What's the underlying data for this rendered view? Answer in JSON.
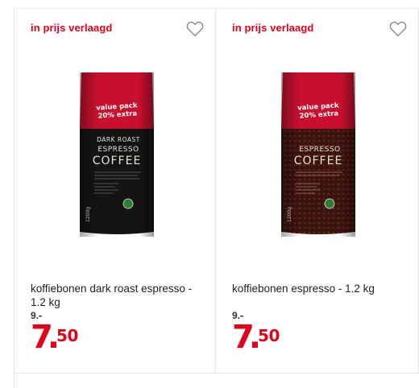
{
  "products": [
    {
      "badge": "in prijs verlaagd",
      "name": "koffiebonen dark roast espresso - 1.2 kg",
      "old_price": "9.-",
      "old_price_main": "9.",
      "old_price_dash": "-",
      "price_whole": "7",
      "price_dot": ".",
      "price_cents": "50",
      "pack": {
        "line1": "value pack",
        "line2": "20% extra",
        "sub": "DARK ROAST",
        "title1": "ESPRESSO",
        "title2": "COFFEE",
        "weight": "1200g"
      },
      "colors": {
        "top": "#c8102e",
        "body": "#141414"
      }
    },
    {
      "badge": "in prijs verlaagd",
      "name": "koffiebonen espresso - 1.2 kg",
      "old_price": "9.-",
      "old_price_main": "9.",
      "old_price_dash": "-",
      "price_whole": "7",
      "price_dot": ".",
      "price_cents": "50",
      "pack": {
        "line1": "value pack",
        "line2": "20% extra",
        "sub": "",
        "title1": "ESPRESSO",
        "title2": "COFFEE",
        "weight": "1200g"
      },
      "colors": {
        "top": "#c8102e",
        "body": "#3a1410"
      }
    }
  ],
  "accent_color": "#e2001a",
  "icons": [
    "heart-outline-icon",
    "rainforest-frog-icon"
  ]
}
